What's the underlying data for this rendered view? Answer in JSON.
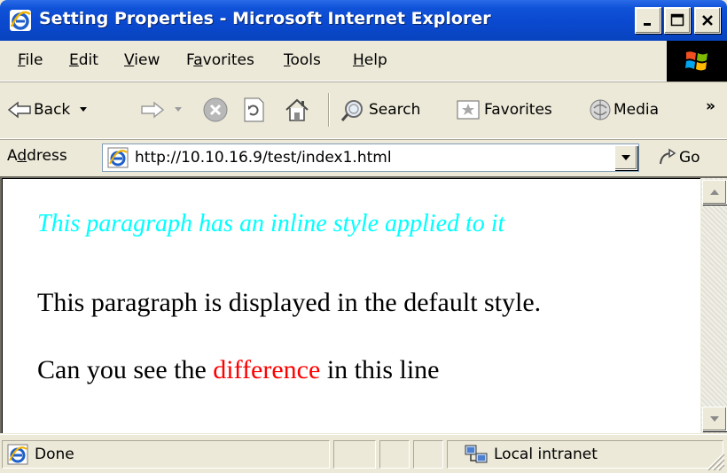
{
  "window": {
    "title": "Setting Properties - Microsoft Internet Explorer",
    "icon": "ie-icon",
    "controls": [
      "minimize-icon",
      "maximize-icon",
      "close-icon"
    ]
  },
  "menu": {
    "items": [
      {
        "label": "File",
        "accel": "F",
        "rest": "ile"
      },
      {
        "label": "Edit",
        "accel": "E",
        "rest": "dit"
      },
      {
        "label": "View",
        "accel": "V",
        "rest": "iew"
      },
      {
        "label": "Favorites",
        "pre": "F",
        "accel": "a",
        "rest": "vorites"
      },
      {
        "label": "Tools",
        "accel": "T",
        "rest": "ools"
      },
      {
        "label": "Help",
        "accel": "H",
        "rest": "elp"
      }
    ]
  },
  "toolbar": {
    "back_label": "Back",
    "search_label": "Search",
    "favorites_label": "Favorites",
    "media_label": "Media",
    "more_glyph": "»"
  },
  "address": {
    "label_pre": "A",
    "label_accel": "d",
    "label_rest": "dress",
    "url": "http://10.10.16.9/test/index1.html",
    "go_label": "Go"
  },
  "content": {
    "paragraph1": "This paragraph has an inline style applied to it",
    "paragraph2": "This paragraph is displayed in the default style.",
    "paragraph3_before": "Can you see the ",
    "paragraph3_highlight": "difference",
    "paragraph3_after": " in this line",
    "colors": {
      "inline_style": "#00FFFF",
      "highlight": "#FF0000"
    }
  },
  "status": {
    "text": "Done",
    "zone": "Local intranet"
  }
}
